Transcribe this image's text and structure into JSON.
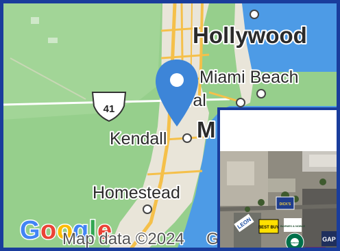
{
  "map": {
    "places": {
      "hollywood": "Hollywood",
      "miami_beach": "Miami Beach",
      "kendall": "Kendall",
      "homestead": "Homestead",
      "partial_m": "M",
      "partial_ral": "ral"
    },
    "highway_shield": "41",
    "attribution": "Map data ©2024",
    "attribution_partial": "G",
    "logo": {
      "G": "G",
      "o1": "o",
      "o2": "o",
      "g": "g",
      "l": "l",
      "e": "e"
    },
    "colors": {
      "land": "#96cf8c",
      "urban": "#e8e4d8",
      "water": "#4d9be6",
      "roads": "#f5c04a",
      "pin": "#3d85d8",
      "frame": "#1a3d9c"
    }
  },
  "inset": {
    "logos": {
      "best_buy": "BEST BUY",
      "leon": "LEON",
      "gap": "GAP",
      "barnes_noble": "BARNES & NOBLE",
      "starbucks": "STARBUCKS",
      "store_sign": "DICK'S"
    }
  }
}
